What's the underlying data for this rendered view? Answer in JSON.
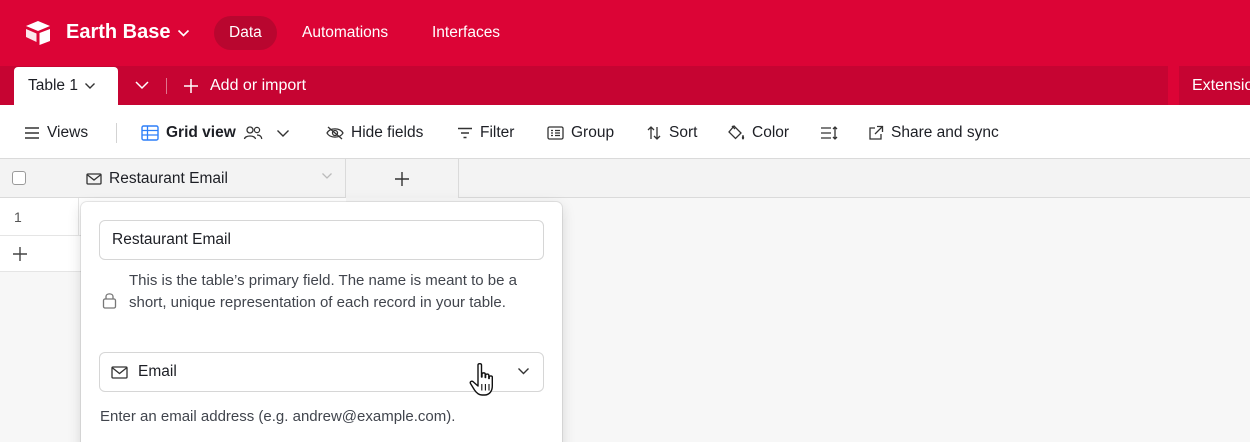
{
  "app": {
    "base_name": "Earth Base",
    "nav_tabs": [
      {
        "label": "Data",
        "active": true
      },
      {
        "label": "Automations",
        "active": false
      },
      {
        "label": "Interfaces",
        "active": false
      }
    ],
    "brand_color": "#dc0436",
    "logo_icon": "airtable-logo-icon"
  },
  "tablebar": {
    "active_table": "Table 1",
    "add_import_label": "Add or import",
    "extensions_label": "Extensions"
  },
  "viewbar": {
    "views_label": "Views",
    "grid_view_label": "Grid view",
    "hide_fields_label": "Hide fields",
    "filter_label": "Filter",
    "group_label": "Group",
    "sort_label": "Sort",
    "color_label": "Color",
    "share_label": "Share and sync"
  },
  "grid": {
    "primary_field_name": "Restaurant Email",
    "rows": [
      {
        "number": "1"
      }
    ]
  },
  "field_editor": {
    "name_value": "Restaurant Email",
    "primary_note": "This is the table’s primary field. The name is meant to be a short, unique representation of each record in your table.",
    "field_type": "Email",
    "type_description": "Enter an email address (e.g. andrew@example.com)."
  }
}
